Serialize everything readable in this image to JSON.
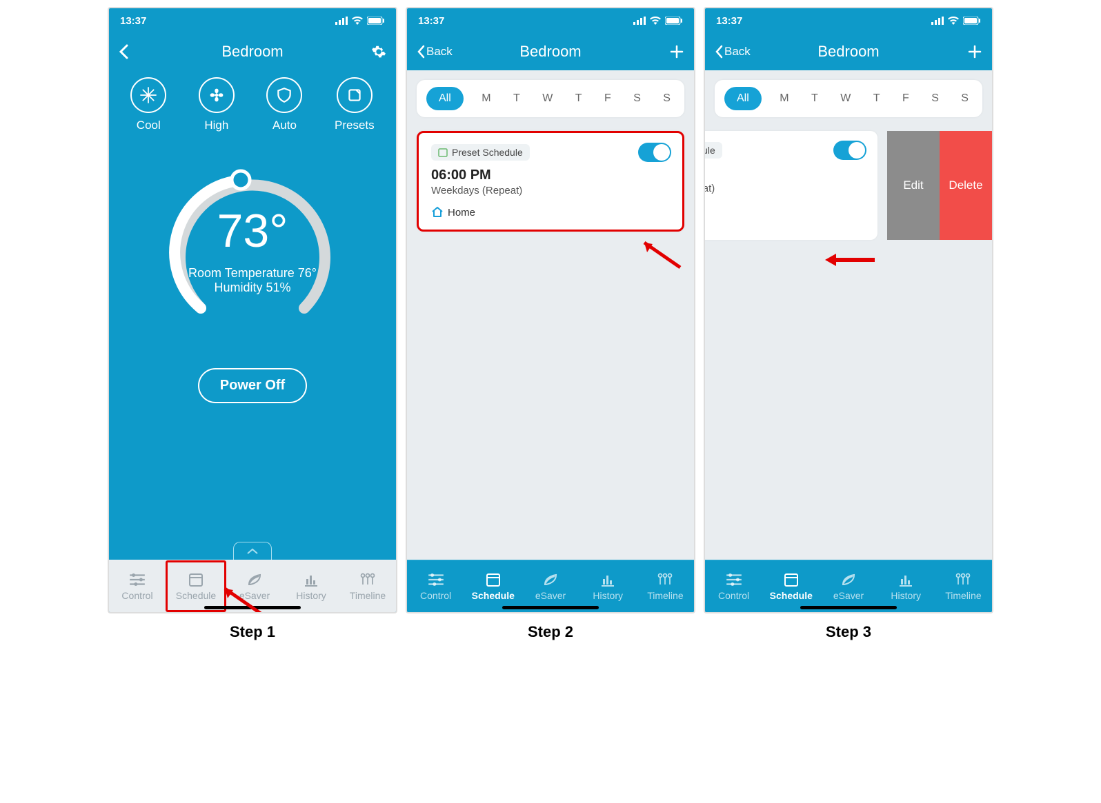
{
  "status": {
    "time": "13:37"
  },
  "steps": {
    "s1": {
      "label": "Step 1"
    },
    "s2": {
      "label": "Step 2"
    },
    "s3": {
      "label": "Step 3"
    }
  },
  "nav": {
    "title": "Bedroom",
    "back": "Back"
  },
  "modes": {
    "cool": "Cool",
    "high": "High",
    "auto": "Auto",
    "presets": "Presets"
  },
  "dial": {
    "setpoint": "73°",
    "room_line": "Room Temperature 76°",
    "humidity_line": "Humidity 51%"
  },
  "power": {
    "label": "Power Off"
  },
  "tabs": {
    "control": "Control",
    "schedule": "Schedule",
    "esaver": "eSaver",
    "history": "History",
    "timeline": "Timeline"
  },
  "days": {
    "all": "All",
    "m": "M",
    "t1": "T",
    "w": "W",
    "t2": "T",
    "f": "F",
    "s1": "S",
    "s2": "S"
  },
  "schedule_card": {
    "badge": "Preset Schedule",
    "time": "06:00 PM",
    "repeat": "Weekdays (Repeat)",
    "preset": "Home"
  },
  "swipe": {
    "edit": "Edit",
    "delete": "Delete"
  }
}
